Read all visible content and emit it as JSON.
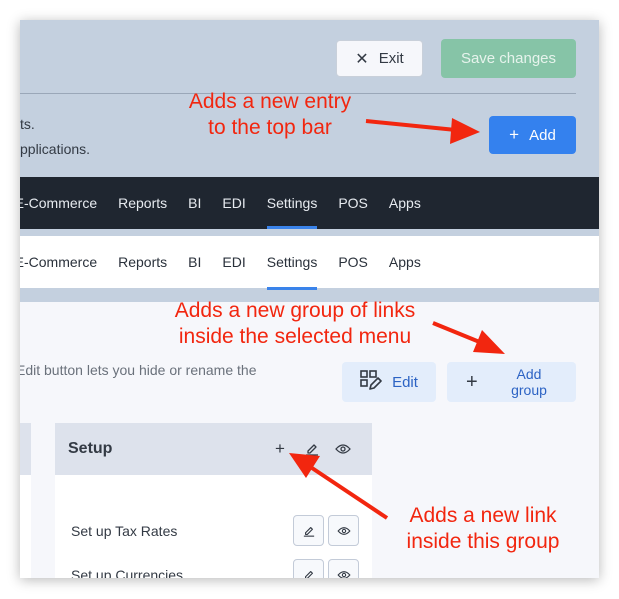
{
  "toolbar": {
    "exit_label": "Exit",
    "exit_icon": "close-icon",
    "save_label": "Save changes",
    "add_label": "Add",
    "add_icon": "plus-icon"
  },
  "description": {
    "line1": "ts.",
    "line2": "pplications."
  },
  "top_nav": {
    "items": [
      {
        "label": "E-Commerce"
      },
      {
        "label": "Reports"
      },
      {
        "label": "BI"
      },
      {
        "label": "EDI"
      },
      {
        "label": "Settings",
        "active": true
      },
      {
        "label": "POS"
      },
      {
        "label": "Apps"
      }
    ]
  },
  "preview_nav": {
    "items": [
      {
        "label": "E-Commerce"
      },
      {
        "label": "Reports"
      },
      {
        "label": "BI"
      },
      {
        "label": "EDI"
      },
      {
        "label": "Settings",
        "active": true
      },
      {
        "label": "POS"
      },
      {
        "label": "Apps"
      }
    ]
  },
  "menu_section": {
    "help_text": "Edit button lets you hide or rename the",
    "edit_label": "Edit",
    "add_group_label": "Add group"
  },
  "group": {
    "title": "Setup",
    "header_icons": [
      "plus-icon",
      "pencil-icon",
      "eye-icon"
    ],
    "links": [
      {
        "label": "Set up Tax Rates"
      },
      {
        "label": "Set up Currencies"
      }
    ]
  },
  "annotations": {
    "top_bar": "Adds a new entry\nto the top bar",
    "group": "Adds a new group of links\ninside the selected menu",
    "link": "Adds a new link\ninside this group"
  },
  "colors": {
    "primary": "#3481ee",
    "save_disabled": "#86c4a7",
    "nav_dark": "#1f2630",
    "annotation": "#f2260f",
    "active_underline": "#3a83ea"
  }
}
